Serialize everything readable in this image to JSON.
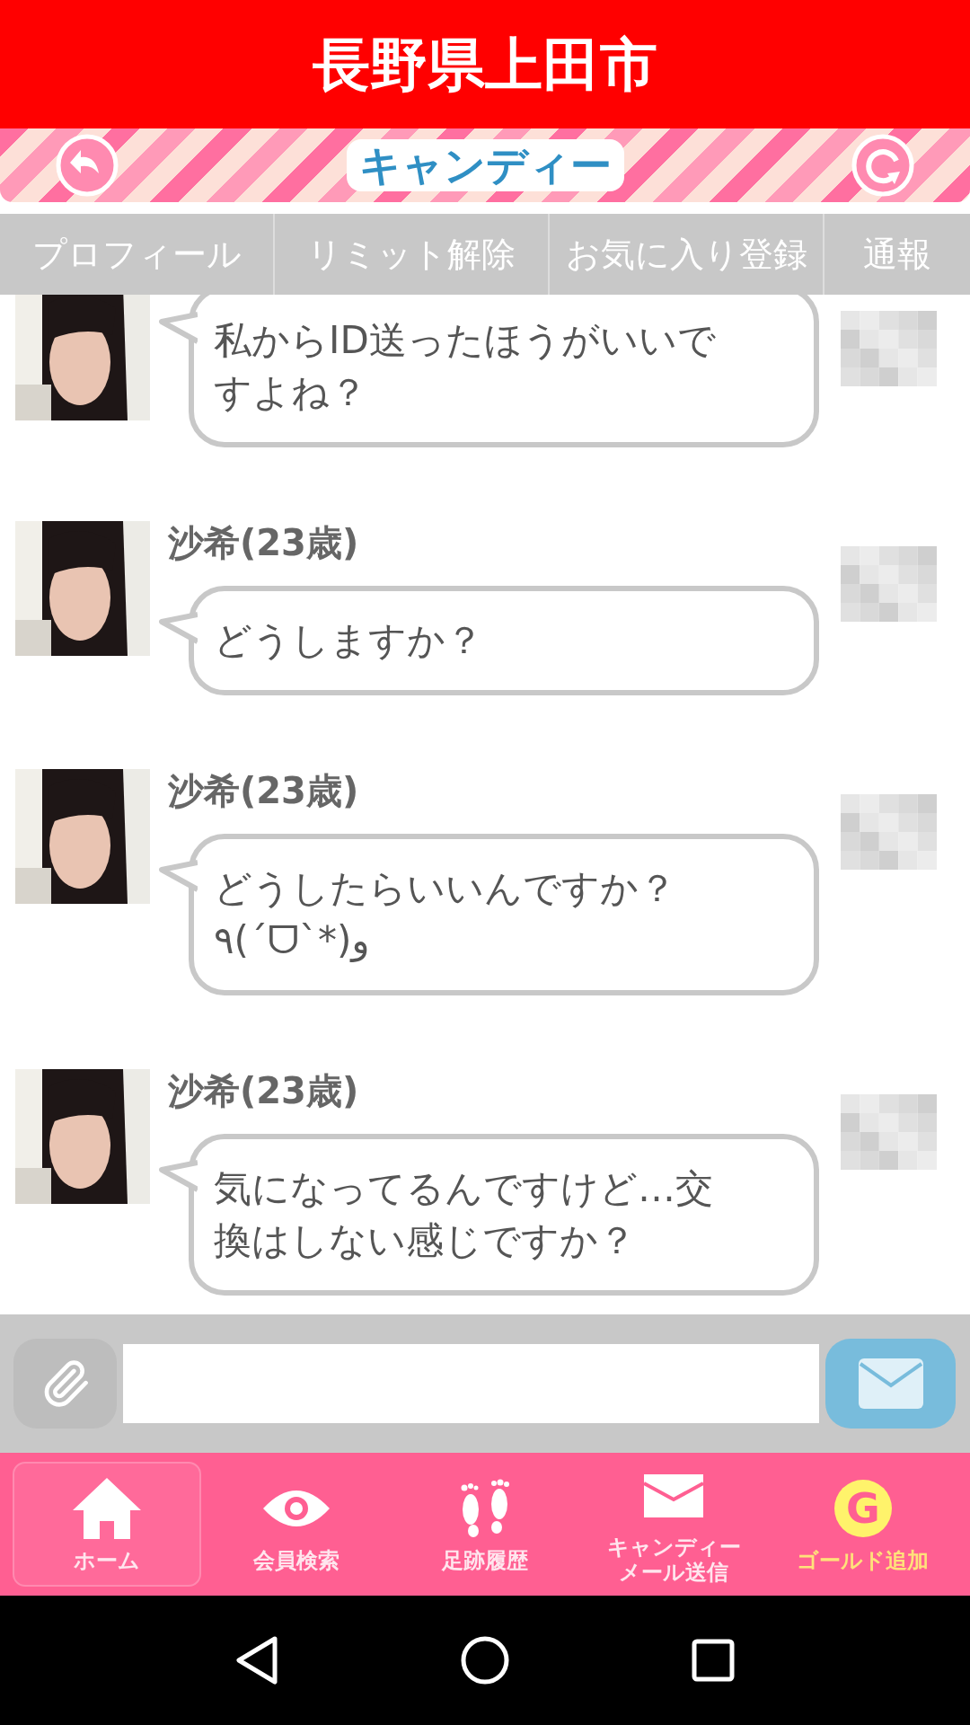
{
  "header": {
    "title": "長野県上田市"
  },
  "banner": {
    "logo": "キャンディー"
  },
  "tabs": [
    {
      "label": "プロフィール"
    },
    {
      "label": "リミット解除"
    },
    {
      "label": "お気に入り登録"
    },
    {
      "label": "通報"
    }
  ],
  "messages": [
    {
      "lines": [
        "私からID送ったほうがいいで",
        "すよね？"
      ]
    },
    {
      "sender": "沙希(23歳)",
      "lines": [
        "どうしますか？"
      ]
    },
    {
      "sender": "沙希(23歳)",
      "lines": [
        "どうしたらいいんですか？",
        "٩(´ᗜ`*)و"
      ]
    },
    {
      "sender": "沙希(23歳)",
      "lines": [
        "気になってるんですけど…交",
        "換はしない感じですか？"
      ]
    }
  ],
  "bottom_nav": [
    {
      "kind": "home",
      "lines": [
        "ホーム"
      ],
      "selected": true
    },
    {
      "kind": "search",
      "lines": [
        "会員検索"
      ],
      "selected": false
    },
    {
      "kind": "footprints",
      "lines": [
        "足跡履歴"
      ],
      "selected": false
    },
    {
      "kind": "mail",
      "lines": [
        "キャンディー",
        "メール送信"
      ],
      "selected": false
    },
    {
      "kind": "gold",
      "lines": [
        "ゴールド追加"
      ],
      "icon_text": "G",
      "selected": false
    }
  ]
}
